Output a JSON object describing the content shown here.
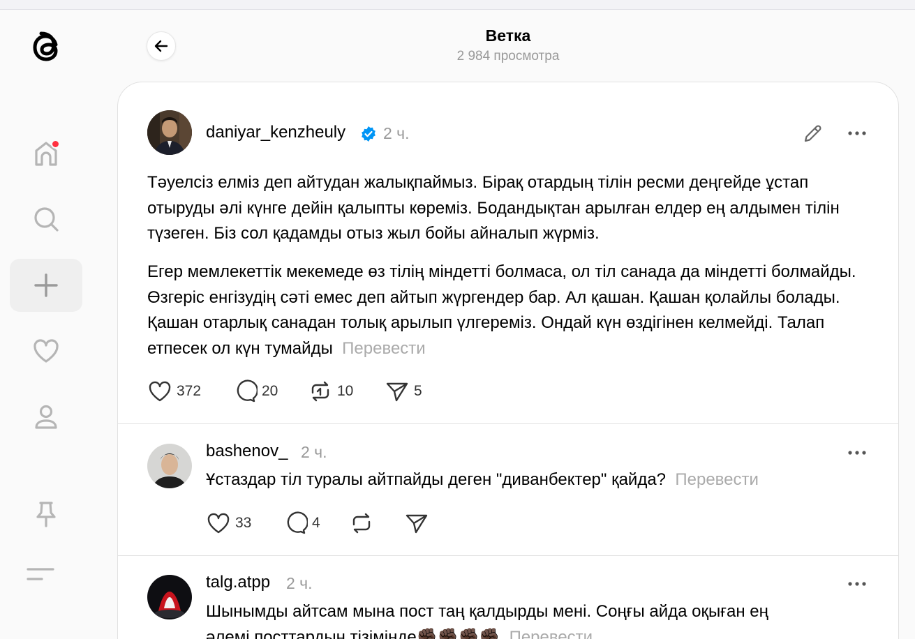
{
  "header": {
    "title": "Ветка",
    "views": "2 984 просмотра"
  },
  "post": {
    "username": "daniyar_kenzheuly",
    "time": "2 ч.",
    "paragraph1": "Тәуелсіз елміз деп айтудан жалықпаймыз. Бірақ отардың тілін ресми деңгейде ұстап отыруды әлі күнге дейін қалыпты көреміз. Бодандықтан арылған елдер ең алдымен тілін түзеген. Біз сол қадамды отыз жыл бойы айналып жүрміз.",
    "paragraph2": "Егер мемлекеттік мекемеде өз тілің міндетті болмаса, ол тіл санада да міндетті болмайды. Өзгеріс енгізудің сәті емес деп айтып жүргендер бар. Ал қашан. Қашан қолайлы болады. Қашан отарлық санадан толық арылып үлгереміз. Ондай күн өздігінен келмейді. Талап етпесек ол күн тумайды",
    "translate": "Перевести",
    "likes": "372",
    "replies": "20",
    "reposts": "10",
    "shares": "5"
  },
  "replies": [
    {
      "username": "bashenov_",
      "time": "2 ч.",
      "text": "Ұстаздар тіл туралы айтпайды деген \"диванбектер\" қайда?",
      "translate": "Перевести",
      "likes": "33",
      "replies": "4"
    },
    {
      "username": "talg.atpp",
      "time": "2 ч.",
      "line1": "Шынымды айтсам мына пост таң қалдырды мені. Соңғы айда оқыған ең",
      "line2": "әлемі посттардың тізімінде✊🏿✊🏿✊🏿✊🏿",
      "translate": "Перевести"
    }
  ],
  "colors": {
    "notification": "#ff3040",
    "verified": "#0095f6",
    "muted": "#999999"
  },
  "icons": [
    "threads-logo-icon",
    "home-icon",
    "search-icon",
    "plus-icon",
    "heart-icon",
    "profile-icon",
    "pin-icon",
    "menu-icon",
    "back-arrow-icon",
    "edit-icon",
    "more-icon",
    "verified-badge-icon",
    "like-icon",
    "comment-icon",
    "repost-icon",
    "share-icon"
  ]
}
